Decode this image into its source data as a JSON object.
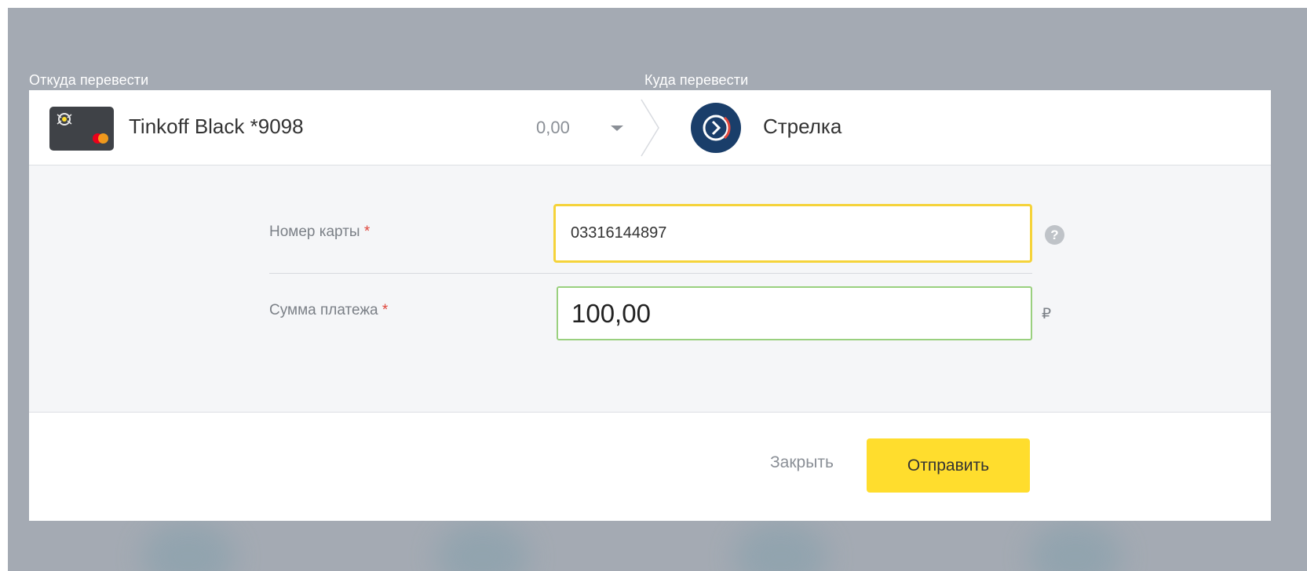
{
  "source": {
    "label": "Откуда перевести",
    "card_name": "Tinkoff Black *9098",
    "balance": "0,00",
    "card_icon": "credit-card-icon"
  },
  "destination": {
    "label": "Куда перевести",
    "name": "Стрелка",
    "logo_icon": "strelka-logo-icon"
  },
  "form": {
    "card_number": {
      "label": "Номер карты",
      "required_mark": "*",
      "value": "03316144897",
      "help_icon": "?"
    },
    "amount": {
      "label": "Сумма платежа",
      "required_mark": "*",
      "value": "100,00",
      "currency": "₽"
    }
  },
  "actions": {
    "close_label": "Закрыть",
    "submit_label": "Отправить"
  },
  "colors": {
    "accent": "#ffdd2d",
    "focus_border": "#f5d33a",
    "valid_border": "#9ad07f",
    "overlay": "#a4aab3",
    "destination_logo": "#1a3e6a"
  }
}
